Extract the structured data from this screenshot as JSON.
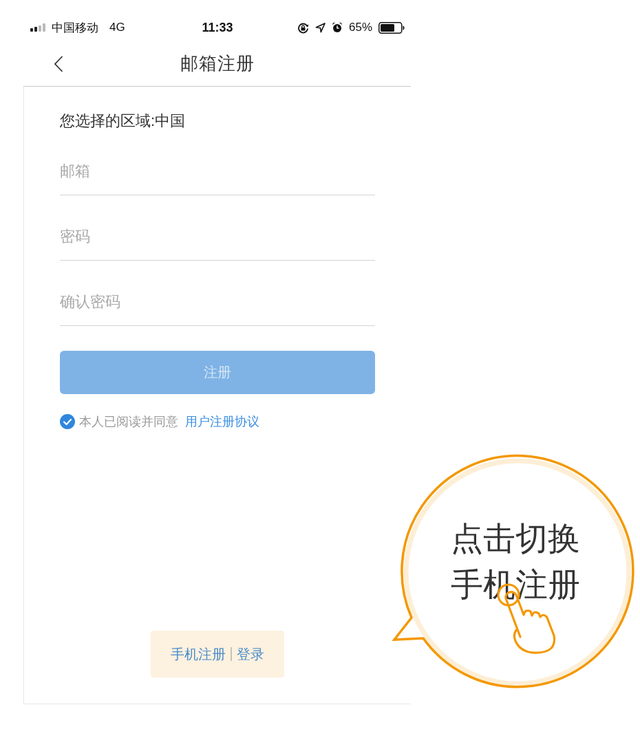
{
  "status_bar": {
    "carrier": "中国移动",
    "network": "4G",
    "time": "11:33",
    "battery": "65%"
  },
  "nav_bar": {
    "title": "邮箱注册"
  },
  "region": {
    "text": "您选择的区域:中国"
  },
  "fields": [
    {
      "placeholder": "邮箱"
    },
    {
      "placeholder": "密码"
    },
    {
      "placeholder": "确认密码"
    }
  ],
  "submit_button": {
    "label": "注册",
    "disabled": true
  },
  "agreement": {
    "checked": true,
    "text": "本人已阅读并同意",
    "link": "用户注册协议"
  },
  "footer": {
    "highlighted": true,
    "links": [
      {
        "label": "手机注册"
      },
      {
        "label": "登录"
      }
    ]
  },
  "callout": {
    "text": "点击切换手机注册"
  }
}
